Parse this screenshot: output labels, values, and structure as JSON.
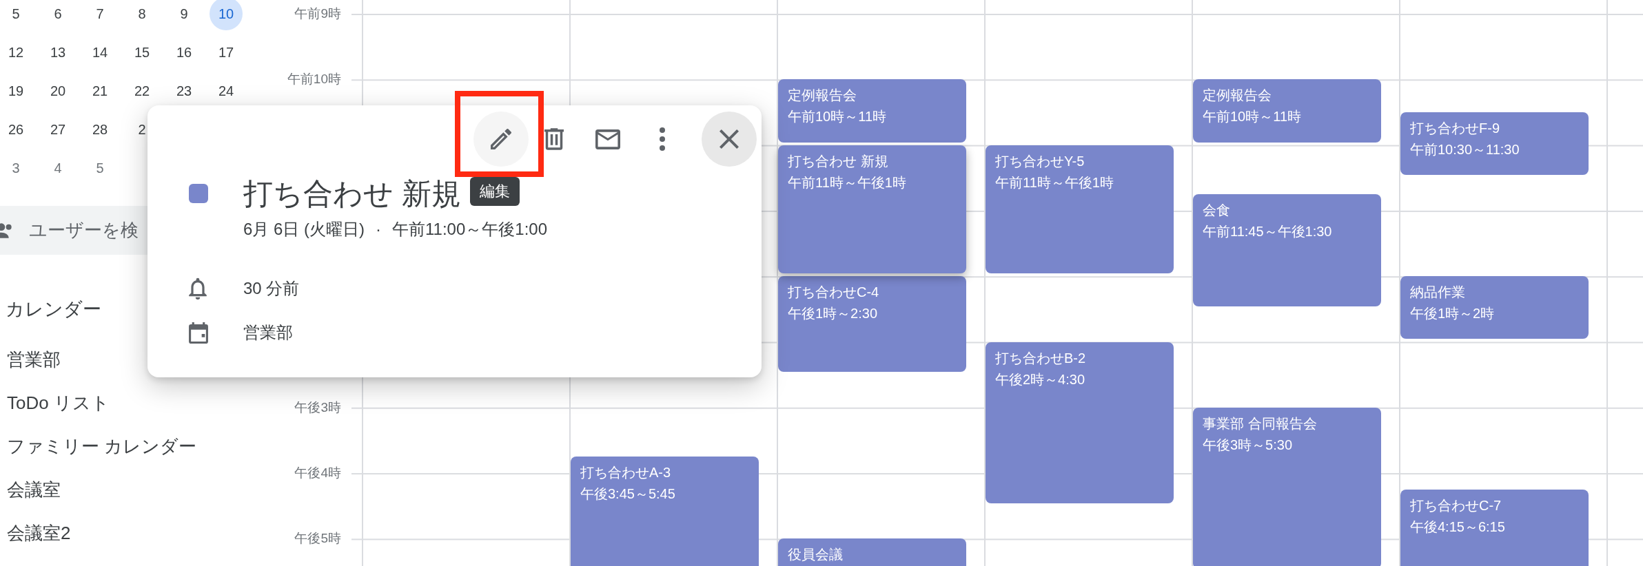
{
  "sidebar": {
    "mini_calendar": {
      "weeks": [
        [
          {
            "label": "5",
            "today": false,
            "other_month": false
          },
          {
            "label": "6",
            "today": false,
            "other_month": false
          },
          {
            "label": "7",
            "today": false,
            "other_month": false
          },
          {
            "label": "8",
            "today": false,
            "other_month": false
          },
          {
            "label": "9",
            "today": false,
            "other_month": false
          },
          {
            "label": "10",
            "today": true,
            "other_month": false
          }
        ],
        [
          {
            "label": "12",
            "today": false,
            "other_month": false
          },
          {
            "label": "13",
            "today": false,
            "other_month": false
          },
          {
            "label": "14",
            "today": false,
            "other_month": false
          },
          {
            "label": "15",
            "today": false,
            "other_month": false
          },
          {
            "label": "16",
            "today": false,
            "other_month": false
          },
          {
            "label": "17",
            "today": false,
            "other_month": false
          }
        ],
        [
          {
            "label": "19",
            "today": false,
            "other_month": false
          },
          {
            "label": "20",
            "today": false,
            "other_month": false
          },
          {
            "label": "21",
            "today": false,
            "other_month": false
          },
          {
            "label": "22",
            "today": false,
            "other_month": false
          },
          {
            "label": "23",
            "today": false,
            "other_month": false
          },
          {
            "label": "24",
            "today": false,
            "other_month": false
          }
        ],
        [
          {
            "label": "26",
            "today": false,
            "other_month": false
          },
          {
            "label": "27",
            "today": false,
            "other_month": false
          },
          {
            "label": "28",
            "today": false,
            "other_month": false
          },
          {
            "label": "2",
            "today": false,
            "other_month": false
          }
        ],
        [
          {
            "label": "3",
            "today": false,
            "other_month": true
          },
          {
            "label": "4",
            "today": false,
            "other_month": true
          },
          {
            "label": "5",
            "today": false,
            "other_month": true
          }
        ]
      ]
    },
    "people_search": {
      "placeholder": "ユーザーを検"
    },
    "calendars_heading": "カレンダー",
    "calendars": [
      {
        "label": "営業部"
      },
      {
        "label": "ToDo リスト"
      },
      {
        "label": "ファミリー カレンダー"
      },
      {
        "label": "会議室"
      },
      {
        "label": "会議室2"
      }
    ]
  },
  "time_labels": [
    "午前9時",
    "午前10時",
    "午後3時",
    "午後4時",
    "午後5時"
  ],
  "days": [
    {
      "events": [
        {
          "title": "打ち合わせA-3",
          "time": "午後3:45～5:45",
          "selected": false
        }
      ]
    },
    {
      "events": [
        {
          "title": "定例報告会",
          "time": "午前10時～11時",
          "selected": false
        },
        {
          "title": "打ち合わせ 新規",
          "time": "午前11時～午後1時",
          "selected": true
        },
        {
          "title": "打ち合わせC-4",
          "time": "午後1時～2:30",
          "selected": false
        },
        {
          "title": "役員会議",
          "selected": false
        }
      ]
    },
    {
      "events": [
        {
          "title": "打ち合わせY-5",
          "time": "午前11時～午後1時",
          "selected": false
        },
        {
          "title": "打ち合わせB-2",
          "time": "午後2時～4:30",
          "selected": false
        }
      ]
    },
    {
      "events": [
        {
          "title": "定例報告会",
          "time": "午前10時～11時",
          "selected": false
        },
        {
          "title": "会食",
          "time": "午前11:45～午後1:30",
          "selected": false
        },
        {
          "title": "事業部 合同報告会",
          "time": "午後3時～5:30",
          "selected": false
        }
      ]
    },
    {
      "events": [
        {
          "title": "打ち合わせF-9",
          "time": "午前10:30～11:30",
          "selected": false
        },
        {
          "title": "納品作業",
          "time": "午後1時～2時",
          "selected": false
        },
        {
          "title": "打ち合わせC-7",
          "time": "午後4:15～6:15",
          "selected": false
        }
      ]
    }
  ],
  "popup": {
    "toolbar": [
      {
        "kind": "edit",
        "highlighted": true
      },
      {
        "kind": "delete",
        "highlighted": false
      },
      {
        "kind": "email",
        "highlighted": false
      },
      {
        "kind": "more",
        "highlighted": false
      },
      {
        "kind": "close",
        "highlighted": false
      }
    ],
    "tooltip": "編集",
    "color": "#7986cb",
    "title": "打ち合わせ 新規",
    "date": "6月 6日 (火曜日)",
    "separator": "·",
    "time": "午前11:00～午後1:00",
    "reminder": "30 分前",
    "calendar": "営業部"
  }
}
